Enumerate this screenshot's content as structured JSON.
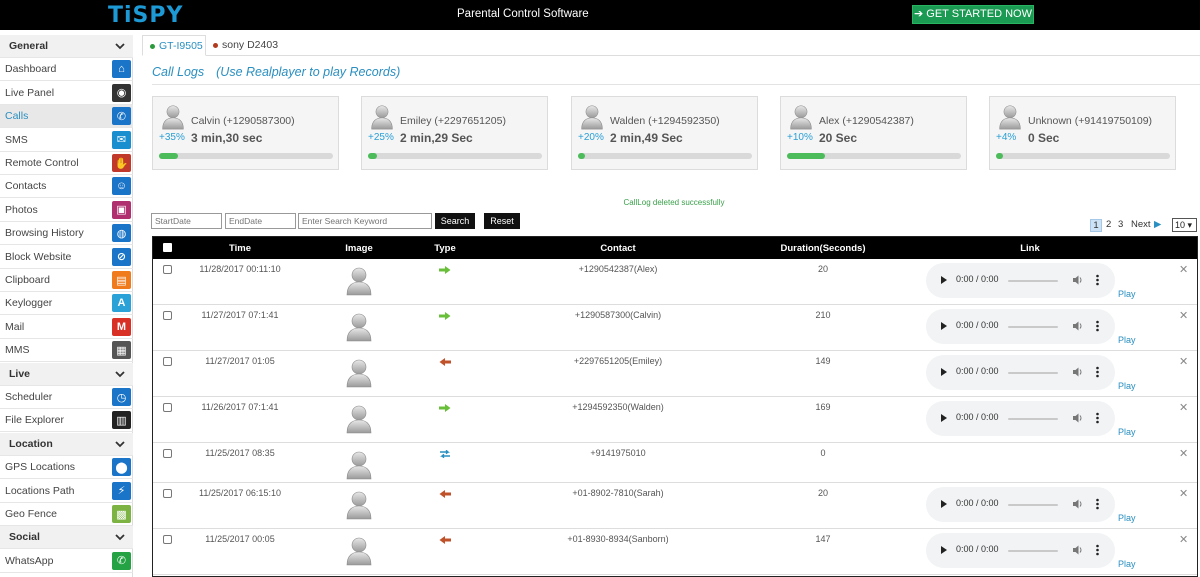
{
  "header": {
    "logo": "TiSPY",
    "title": "Parental Control Software",
    "cta": "GET STARTED NOW"
  },
  "sidebar": {
    "rows": [
      {
        "label": "General",
        "header": true
      },
      {
        "label": "Dashboard",
        "icon": "home-icon",
        "color": "#1a74c7"
      },
      {
        "label": "Live Panel",
        "icon": "camera-icon",
        "color": "#333333"
      },
      {
        "label": "Calls",
        "icon": "phone-icon",
        "color": "#1a74c7",
        "active": true
      },
      {
        "label": "SMS",
        "icon": "envelope-icon",
        "color": "#1a8fd0"
      },
      {
        "label": "Remote Control",
        "icon": "remote-control-icon",
        "color": "#c0392b"
      },
      {
        "label": "Contacts",
        "icon": "contacts-icon",
        "color": "#1a74c7"
      },
      {
        "label": "Photos",
        "icon": "photos-icon",
        "color": "#b0306f"
      },
      {
        "label": "Browsing History",
        "icon": "globe-icon",
        "color": "#1a74c7"
      },
      {
        "label": "Block Website",
        "icon": "block-website-icon",
        "color": "#1a74c7"
      },
      {
        "label": "Clipboard",
        "icon": "clipboard-icon",
        "color": "#f07b1d"
      },
      {
        "label": "Keylogger",
        "icon": "keylogger-icon",
        "color": "#2aa1d7"
      },
      {
        "label": "Mail",
        "icon": "gmail-icon",
        "color": "#d93025"
      },
      {
        "label": "MMS",
        "icon": "mms-icon",
        "color": "#555555"
      },
      {
        "label": "Live",
        "header": true
      },
      {
        "label": "Scheduler",
        "icon": "clock-icon",
        "color": "#1a74c7"
      },
      {
        "label": "File Explorer",
        "icon": "file-explorer-icon",
        "color": "#222222"
      },
      {
        "label": "Location",
        "header": true
      },
      {
        "label": "GPS Locations",
        "icon": "map-pin-icon",
        "color": "#1a74c7"
      },
      {
        "label": "Locations Path",
        "icon": "location-path-icon",
        "color": "#1a74c7"
      },
      {
        "label": "Geo Fence",
        "icon": "geo-fence-icon",
        "color": "#7cb342"
      },
      {
        "label": "Social",
        "header": true
      },
      {
        "label": "WhatsApp",
        "icon": "whatsapp-icon",
        "color": "#25a244"
      }
    ]
  },
  "tabs": [
    {
      "label": "GT-I9505",
      "dot_color": "#2a9a3c"
    },
    {
      "label": "sony D2403",
      "dot_color": "#b23a1e"
    }
  ],
  "page": {
    "title": "Call Logs",
    "subtitle": "(Use Realplayer to play Records)"
  },
  "cards": [
    {
      "name": "Calvin (+1290587300)",
      "pct": "+35%",
      "duration": "3 min,30 sec",
      "fill": 0.11
    },
    {
      "name": "Emiley (+2297651205)",
      "pct": "+25%",
      "duration": "2 min,29 Sec",
      "fill": 0.05
    },
    {
      "name": "Walden (+1294592350)",
      "pct": "+20%",
      "duration": "2 min,49 Sec",
      "fill": 0.04
    },
    {
      "name": "Alex (+1290542387)",
      "pct": "+10%",
      "duration": "20 Sec",
      "fill": 0.22
    },
    {
      "name": "Unknown (+91419750109)",
      "pct": "+4%",
      "duration": "0 Sec",
      "fill": 0.04
    }
  ],
  "status_message": "CallLog deleted successfully",
  "filters": {
    "start_placeholder": "StartDate",
    "end_placeholder": "EndDate",
    "keyword_placeholder": "Enter Search Keyword",
    "search_label": "Search",
    "reset_label": "Reset"
  },
  "pagination": {
    "pages": [
      "1",
      "2",
      "3"
    ],
    "next_label": "Next",
    "next_arrow": "▶",
    "per_page": "10 ▾"
  },
  "table": {
    "columns": [
      "Time",
      "Image",
      "Type",
      "Contact",
      "Duration(Seconds)",
      "Link"
    ],
    "rows": [
      {
        "time": "11/28/2017 00:11:10",
        "type": "outgoing",
        "contact": "+1290542387(Alex)",
        "duration": "20",
        "player_time": "0:00 / 0:00",
        "play": "Play"
      },
      {
        "time": "11/27/2017 07:1:41",
        "type": "outgoing",
        "contact": "+1290587300(Calvin)",
        "duration": "210",
        "player_time": "0:00 / 0:00",
        "play": "Play"
      },
      {
        "time": "11/27/2017 01:05",
        "type": "incoming",
        "contact": "+2297651205(Emiley)",
        "duration": "149",
        "player_time": "0:00 / 0:00",
        "play": "Play"
      },
      {
        "time": "11/26/2017 07:1:41",
        "type": "outgoing",
        "contact": "+1294592350(Walden)",
        "duration": "169",
        "player_time": "0:00 / 0:00",
        "play": "Play"
      },
      {
        "time": "11/25/2017 08:35",
        "type": "missed",
        "contact": "+9141975010",
        "duration": "0",
        "player_time": "",
        "play": ""
      },
      {
        "time": "11/25/2017 06:15:10",
        "type": "incoming",
        "contact": "+01-8902-7810(Sarah)",
        "duration": "20",
        "player_time": "0:00 / 0:00",
        "play": "Play"
      },
      {
        "time": "11/25/2017 00:05",
        "type": "incoming",
        "contact": "+01-8930-8934(Sanborn)",
        "duration": "147",
        "player_time": "0:00 / 0:00",
        "play": "Play"
      }
    ]
  }
}
